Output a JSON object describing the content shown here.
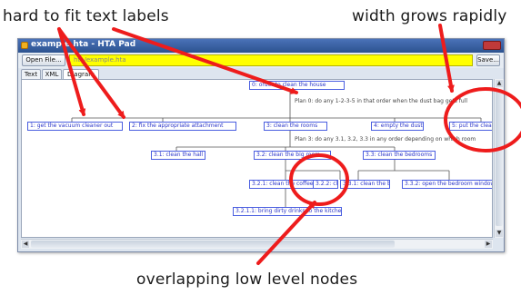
{
  "captions": {
    "hard_to_fit": "hard to fit text labels",
    "width_grows": "width grows rapidly",
    "overlapping": "overlapping low level nodes"
  },
  "window": {
    "title": "example.hta - HTA Pad",
    "open_label": "Open File...",
    "path_value": "hta/example.hta",
    "save_label": "Save..."
  },
  "tabs": [
    {
      "label": "Text"
    },
    {
      "label": "XML"
    },
    {
      "label": "Diagram"
    }
  ],
  "diagram": {
    "root": "0: order to clean the house",
    "plan0": "Plan 0: do any 1-2-3-5 in that order when the dust bag gets full",
    "level1": [
      "1: get the vacuum cleaner out",
      "2: fix the appropriate attachment",
      "3: clean the rooms",
      "4: empty the dustbag",
      "5: put the clean"
    ],
    "plan3": "Plan 3: do any 3.1, 3.2, 3.3 in any order depending on which room",
    "level2": [
      "3.1: clean the hall",
      "3.2: clean the big room",
      "3.3: clean the bedrooms"
    ],
    "level3": [
      "3.2.1: clean the coffee table",
      "3.2.2: clean the stairs",
      "3.3.1: clean the bed",
      "3.3.2: open the bedroom window"
    ],
    "level4": "3.2.1.1: bring dirty drinks to the kitchen"
  },
  "colors": {
    "accent": "#ee1c1c",
    "highlight_field": "#ffff00",
    "node_border": "#4a5ee0"
  }
}
